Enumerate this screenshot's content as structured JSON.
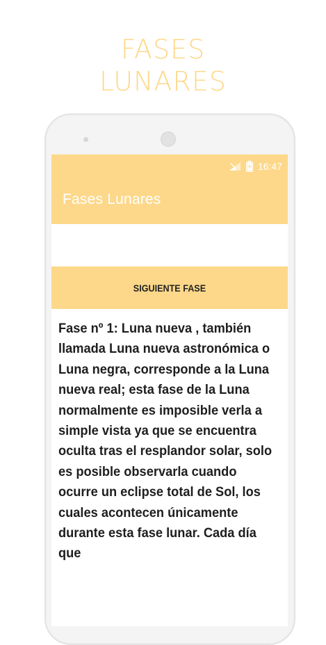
{
  "promo": {
    "title_line1": "FASES",
    "title_line2": "LUNARES"
  },
  "status_bar": {
    "time": "16:47",
    "icons": [
      "signal-icon",
      "battery-icon"
    ]
  },
  "app_bar": {
    "title": "Fases Lunares"
  },
  "main": {
    "next_button_label": "SIGUIENTE FASE",
    "phase_text": "Fase nº 1: Luna nueva , también llamada Luna nueva astronómica o Luna negra, corresponde a la Luna nueva real; esta fase de la Luna normalmente es imposible verla a simple vista ya que se encuentra oculta tras el resplandor solar, solo es posible observarla cuando ocurre un eclipse total de Sol, los cuales acontecen únicamente durante esta fase lunar. Cada día que"
  },
  "colors": {
    "accent": "#fdd88a",
    "text": "#1e1e1e",
    "on_accent": "#ffffff"
  }
}
